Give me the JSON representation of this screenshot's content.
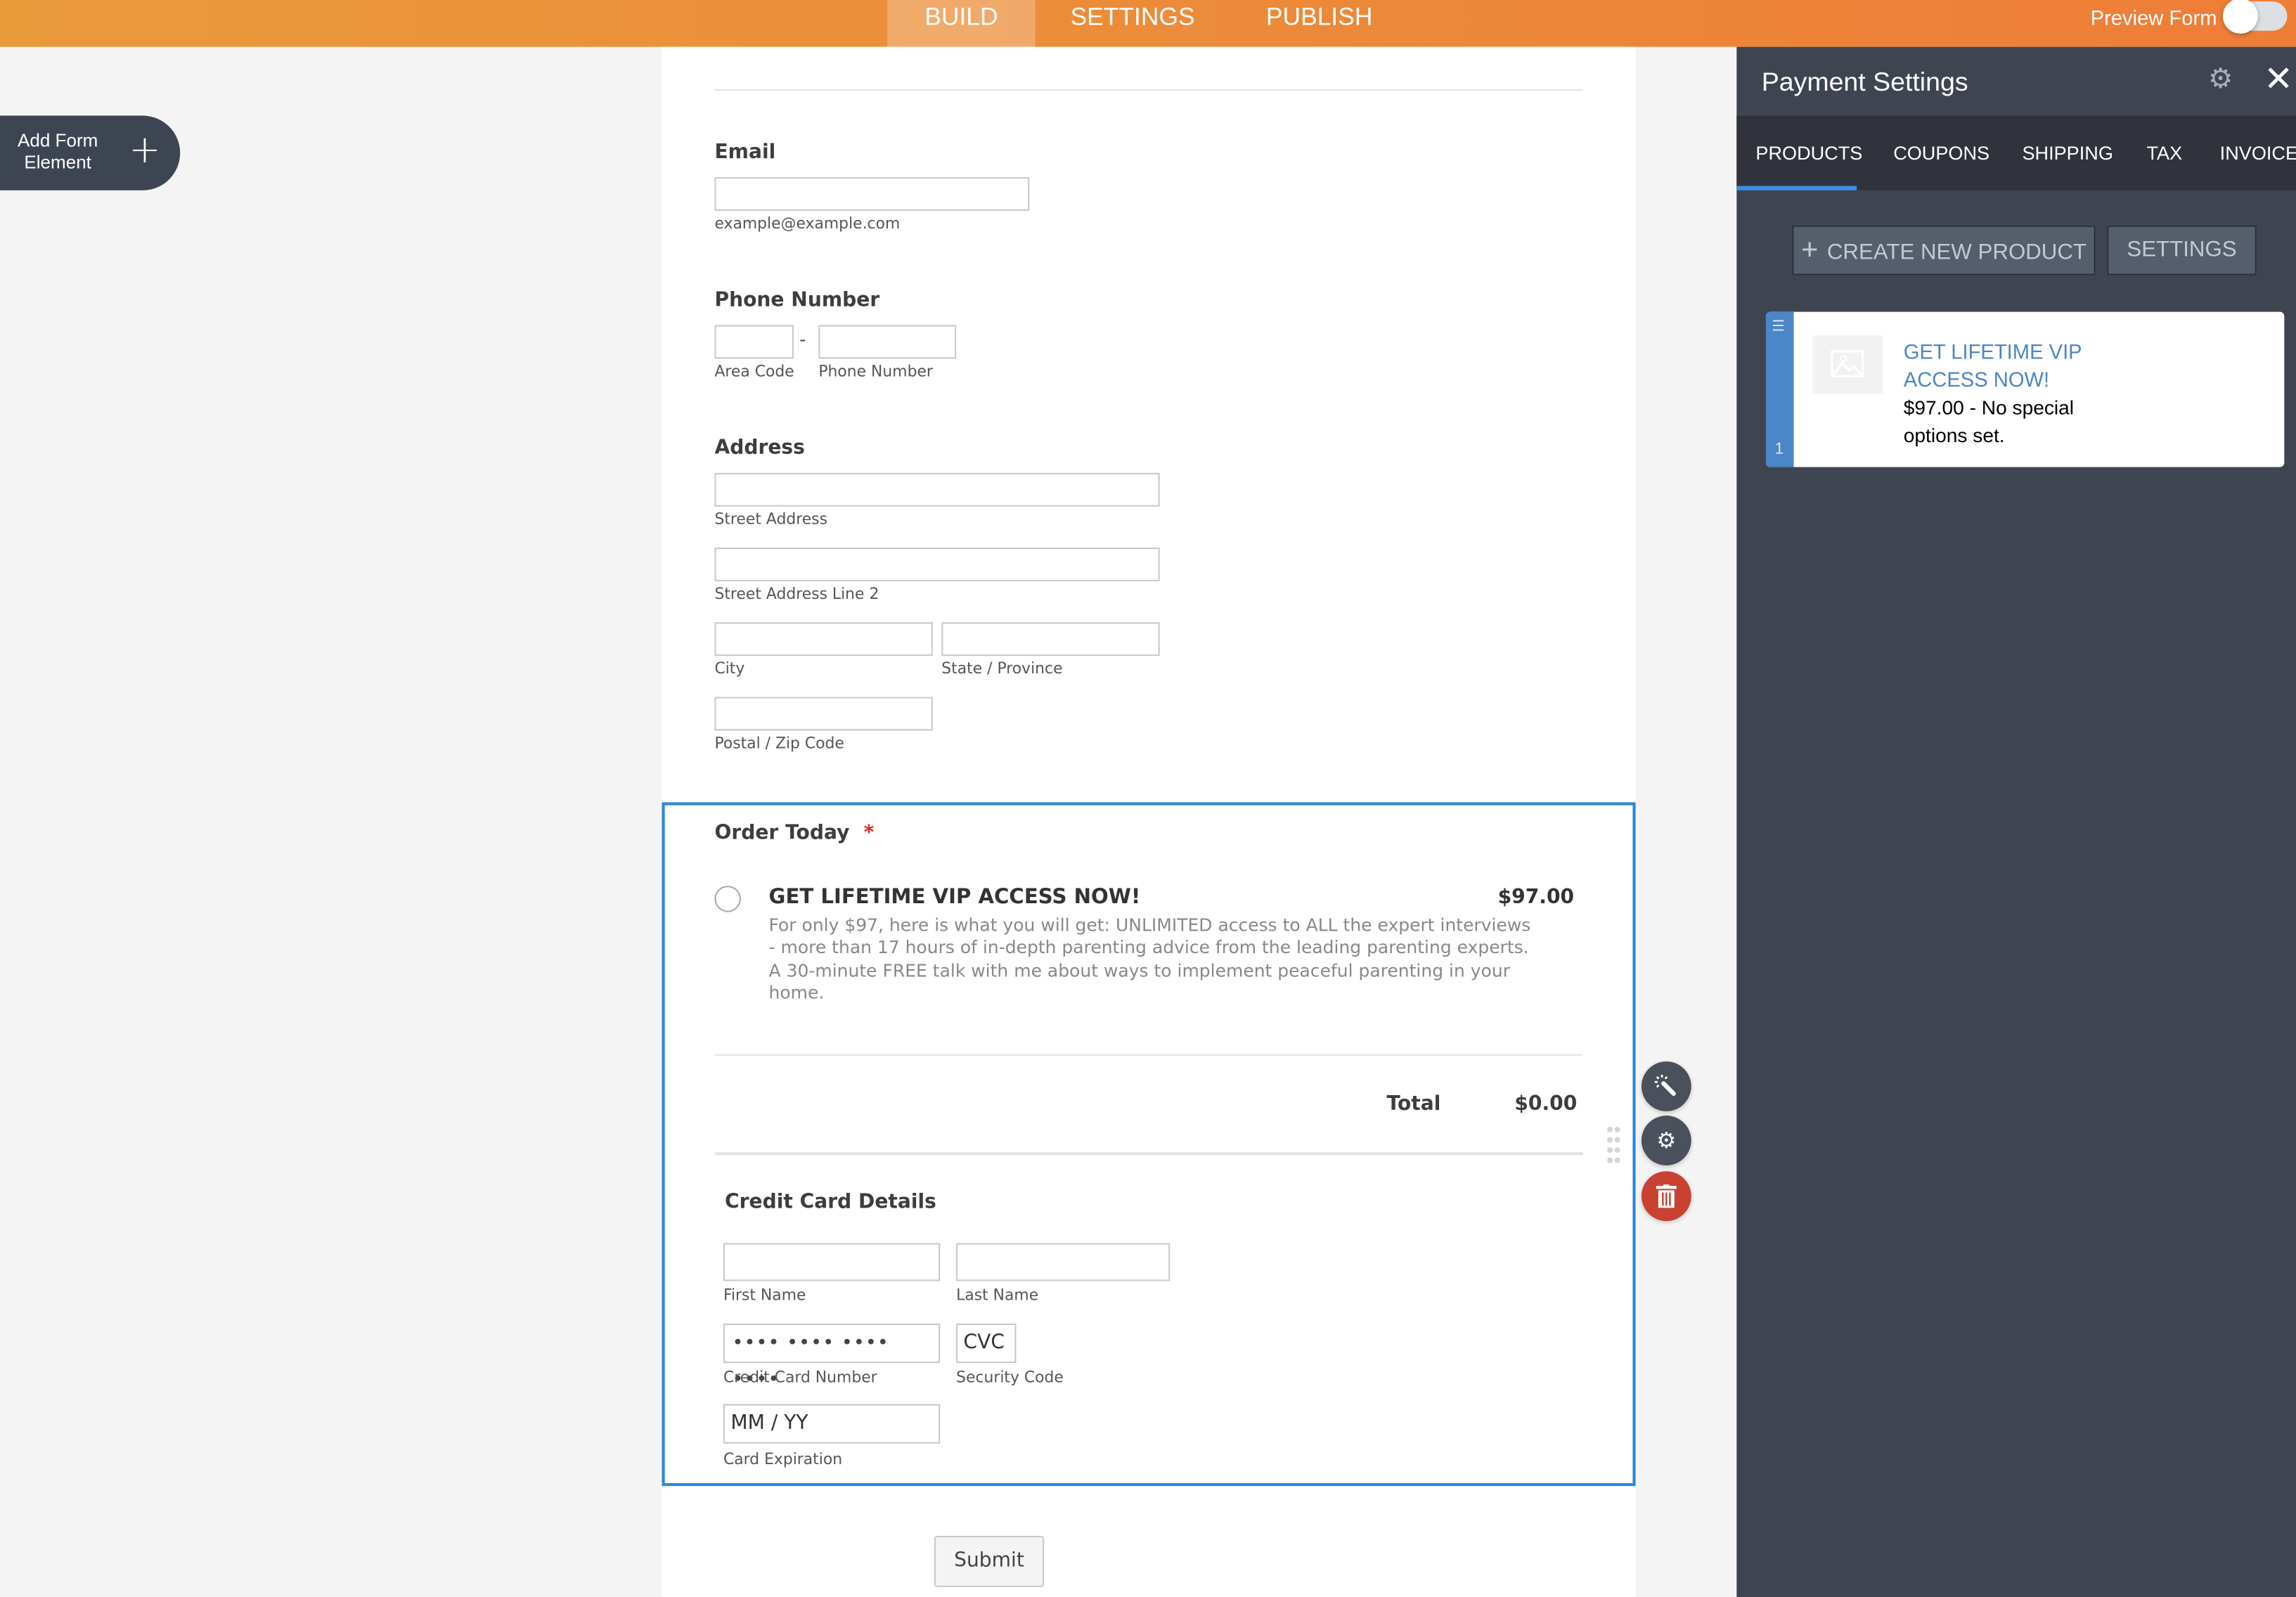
{
  "topbar": {
    "tabs": [
      "BUILD",
      "SETTINGS",
      "PUBLISH"
    ],
    "active_tab": "BUILD",
    "preview_label": "Preview Form",
    "preview_on": false,
    "accent": "#ef7f36"
  },
  "add_element": {
    "label_line1": "Add Form",
    "label_line2": "Element",
    "icon": "plus-icon"
  },
  "form": {
    "email": {
      "label": "Email",
      "value": "",
      "sublabel": "example@example.com"
    },
    "phone": {
      "label": "Phone Number",
      "separator": "-",
      "area_label": "Area Code",
      "number_label": "Phone Number"
    },
    "address": {
      "label": "Address",
      "street": "Street Address",
      "street2": "Street Address Line 2",
      "city": "City",
      "state": "State / Province",
      "postal": "Postal / Zip Code"
    },
    "order": {
      "label": "Order Today",
      "required_mark": "*",
      "product": {
        "name": "GET LIFETIME VIP ACCESS NOW!",
        "price": "$97.00",
        "selected": false,
        "description": "For only $97, here is what you will get: UNLIMITED access to ALL the expert interviews - more than 17 hours of in-depth parenting advice from the leading parenting experts. A 30-minute FREE talk with me about ways to implement peaceful parenting in your home."
      },
      "total_label": "Total",
      "total_value": "$0.00",
      "cc": {
        "title": "Credit Card Details",
        "first_name": "First Name",
        "last_name": "Last Name",
        "card_number_placeholder": "•••• •••• •••• ••••",
        "card_number_label": "Credit Card Number",
        "cvc_placeholder": "CVC",
        "cvc_label": "Security Code",
        "expiry_placeholder": "MM / YY",
        "expiry_label": "Card Expiration"
      }
    },
    "submit_label": "Submit",
    "selected_color": "#2b87da"
  },
  "field_actions": [
    "wand-icon",
    "gear-icon",
    "trash-icon"
  ],
  "panel": {
    "title": "Payment Settings",
    "tabs": [
      "PRODUCTS",
      "COUPONS",
      "SHIPPING",
      "TAX",
      "INVOICE"
    ],
    "active_tab": "PRODUCTS",
    "create_label": "CREATE NEW PRODUCT",
    "settings_label": "SETTINGS",
    "products": [
      {
        "index": "1",
        "name": "GET LIFETIME VIP ACCESS NOW!",
        "details": "$97.00 - No special options set."
      }
    ]
  }
}
